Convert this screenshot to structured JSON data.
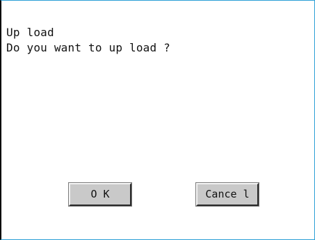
{
  "dialog": {
    "title": "Up load",
    "message": "Do you want to up load ?",
    "ok_label": "O K",
    "cancel_label": "Cance l"
  },
  "colors": {
    "border_accent": "#2a9fd6",
    "button_face": "#c9c9c9"
  }
}
